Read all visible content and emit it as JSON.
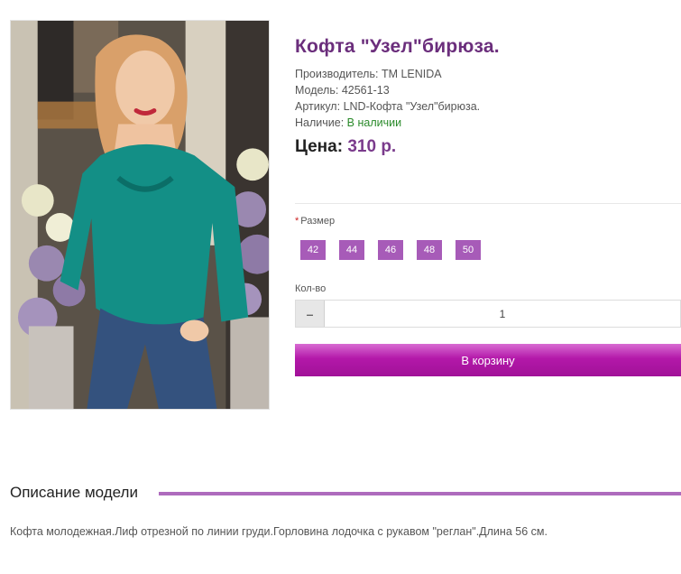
{
  "product": {
    "title": "Кофта \"Узел\"бирюза.",
    "image_alt": "woman-in-teal-sweater-photo",
    "manufacturer_label": "Производитель:",
    "manufacturer_value": "TM LENIDA",
    "model_label": "Модель:",
    "model_value": "42561-13",
    "article_label": "Артикул:",
    "article_value": "LND-Кофта \"Узел\"бирюза.",
    "availability_label": "Наличие:",
    "availability_value": "В наличии",
    "price_label": "Цена:",
    "price_value": "310 р."
  },
  "options": {
    "required_mark": "*",
    "size_label": "Размер",
    "sizes": [
      "42",
      "44",
      "46",
      "48",
      "50"
    ],
    "qty_label": "Кол-во",
    "qty_minus": "–",
    "qty_value": "1",
    "cart_button": "В корзину"
  },
  "description": {
    "heading": "Описание модели",
    "text": "Кофта молодежная.Лиф отрезной по линии груди.Горловина лодочка с рукавом \"реглан\".Длина 56 см."
  },
  "colors": {
    "title": "#6b2e7c",
    "price": "#7a3b8c",
    "size_button": "#a75bb8",
    "cart_button": "#b318a9",
    "in_stock": "#2a8a2a",
    "accent_line": "#ae6bbd"
  }
}
